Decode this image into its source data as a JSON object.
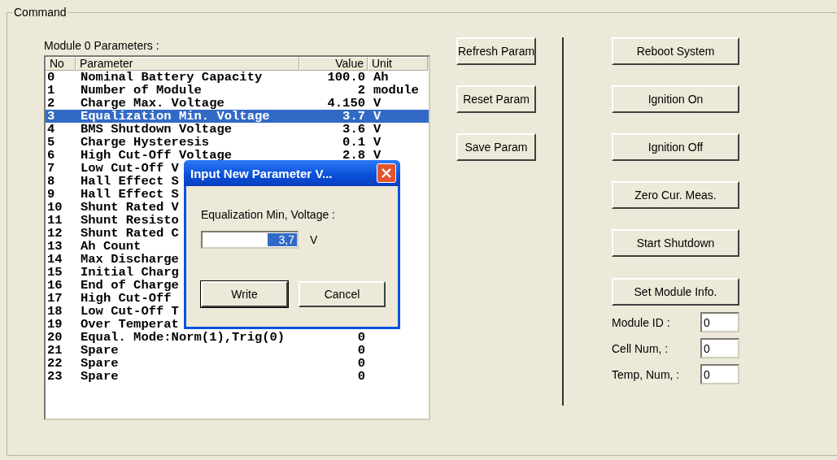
{
  "group": {
    "title": "Command"
  },
  "parameters": {
    "title": "Module 0 Parameters :",
    "columns": [
      "No",
      "Parameter",
      "Value",
      "Unit"
    ],
    "rows": [
      {
        "no": "0",
        "parameter": "Nominal Battery Capacity",
        "value": "100.0",
        "unit": "Ah",
        "selected": false
      },
      {
        "no": "1",
        "parameter": "Number of Module",
        "value": "2",
        "unit": "module",
        "selected": false
      },
      {
        "no": "2",
        "parameter": "Charge Max. Voltage",
        "value": "4.150",
        "unit": "V",
        "selected": false
      },
      {
        "no": "3",
        "parameter": "Equalization Min. Voltage",
        "value": "3.7",
        "unit": "V",
        "selected": true
      },
      {
        "no": "4",
        "parameter": "BMS Shutdown Voltage",
        "value": "3.6",
        "unit": "V",
        "selected": false
      },
      {
        "no": "5",
        "parameter": "Charge Hysteresis",
        "value": "0.1",
        "unit": "V",
        "selected": false
      },
      {
        "no": "6",
        "parameter": "High Cut-Off Voltage",
        "value": "2.8",
        "unit": "V",
        "selected": false
      },
      {
        "no": "7",
        "parameter": "Low Cut-Off V",
        "selected": false
      },
      {
        "no": "8",
        "parameter": "Hall Effect S",
        "selected": false
      },
      {
        "no": "9",
        "parameter": "Hall Effect S",
        "selected": false
      },
      {
        "no": "10",
        "parameter": "Shunt Rated V",
        "selected": false
      },
      {
        "no": "11",
        "parameter": "Shunt Resisto",
        "selected": false
      },
      {
        "no": "12",
        "parameter": "Shunt Rated C",
        "selected": false
      },
      {
        "no": "13",
        "parameter": "Ah Count",
        "selected": false
      },
      {
        "no": "14",
        "parameter": "Max Discharge",
        "selected": false
      },
      {
        "no": "15",
        "parameter": "Initial Charg",
        "selected": false
      },
      {
        "no": "16",
        "parameter": "End of Charge",
        "selected": false
      },
      {
        "no": "17",
        "parameter": "High Cut-Off",
        "selected": false
      },
      {
        "no": "18",
        "parameter": "Low Cut-Off T",
        "selected": false
      },
      {
        "no": "19",
        "parameter": "Over Temperat",
        "selected": false
      },
      {
        "no": "20",
        "parameter": "Equal. Mode:Norm(1),Trig(0)",
        "value": "0",
        "selected": false
      },
      {
        "no": "21",
        "parameter": "Spare",
        "value": "0",
        "selected": false
      },
      {
        "no": "22",
        "parameter": "Spare",
        "value": "0",
        "selected": false
      },
      {
        "no": "23",
        "parameter": "Spare",
        "value": "0",
        "selected": false
      }
    ]
  },
  "param_buttons": [
    "Refresh Param",
    "Reset Param",
    "Save Param"
  ],
  "system_buttons": [
    "Reboot System",
    "Ignition On",
    "Ignition Off",
    "Zero Cur. Meas.",
    "Start Shutdown",
    "Set Module Info."
  ],
  "module_fields": [
    {
      "label": "Module ID :",
      "value": "0"
    },
    {
      "label": "Cell Num, :",
      "value": "0"
    },
    {
      "label": "Temp, Num, :",
      "value": "0"
    }
  ],
  "dialog": {
    "title": "Input New Parameter V...",
    "label": "Equalization Min, Voltage :",
    "value": "3,7",
    "unit": "V",
    "buttons": [
      {
        "label": "Write",
        "default": true
      },
      {
        "label": "Cancel",
        "default": false
      }
    ]
  }
}
